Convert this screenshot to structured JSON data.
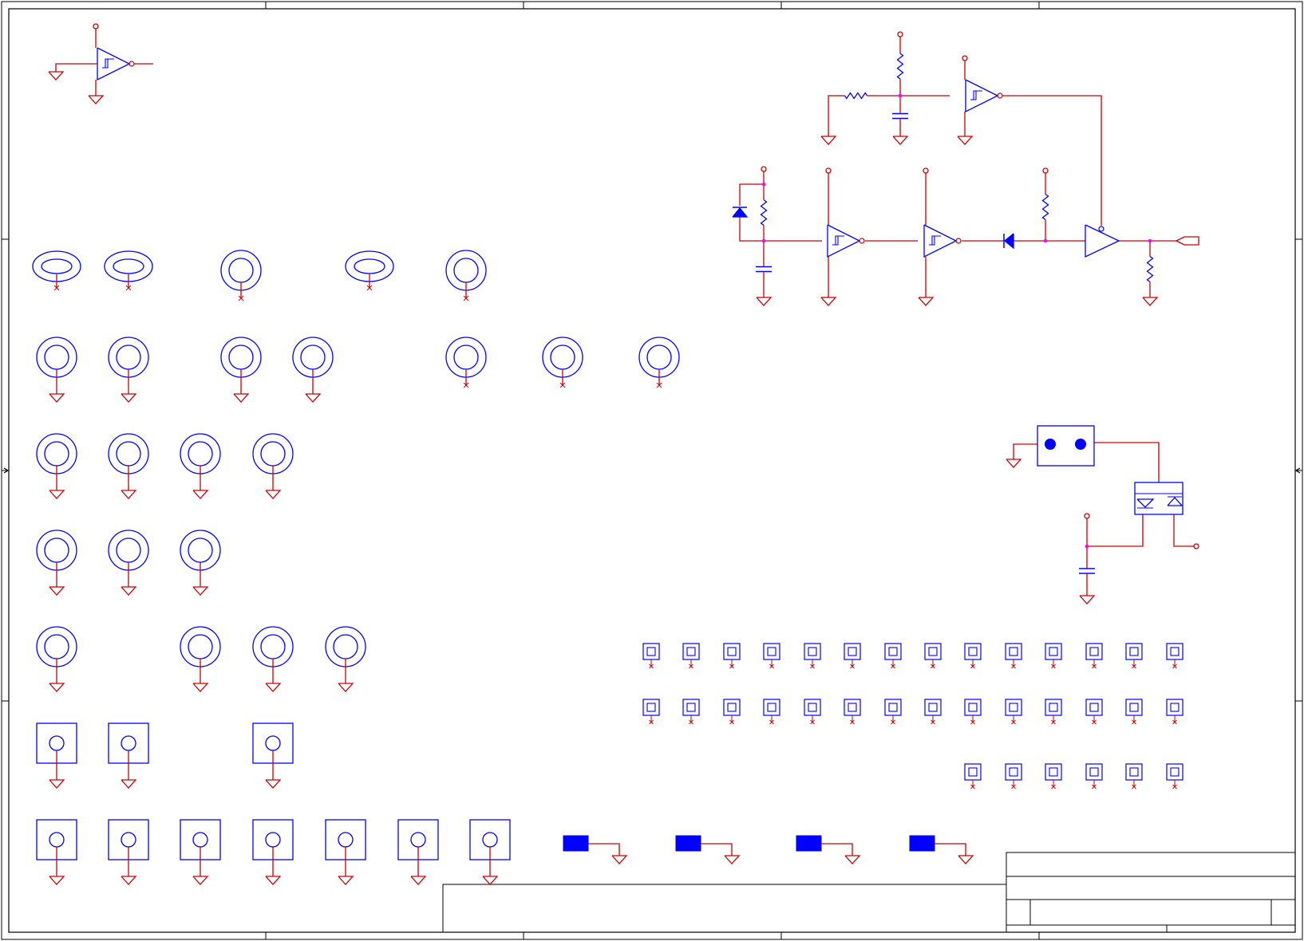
{
  "schematic": {
    "palette": {
      "frame": "#000000",
      "component": "#0000ff",
      "wire": "#cc0000",
      "junction": "#ff00ff",
      "fill_component": "#0000ff"
    },
    "component_groups": [
      {
        "kind": "schmitt-trigger-buffer",
        "count": 4
      },
      {
        "kind": "comparator-buffer",
        "count": 1
      },
      {
        "kind": "resistor",
        "count": 6
      },
      {
        "kind": "capacitor",
        "count": 3
      },
      {
        "kind": "diode",
        "count": 2
      },
      {
        "kind": "oval-mounting-hole",
        "count": 3
      },
      {
        "kind": "round-mounting-hole",
        "count": 24
      },
      {
        "kind": "square-mounting-pad",
        "count": 10
      },
      {
        "kind": "test-point",
        "count": 34
      },
      {
        "kind": "filled-pad",
        "count": 4
      },
      {
        "kind": "two-pin-connector",
        "count": 1
      },
      {
        "kind": "dual-switch-device",
        "count": 1
      }
    ],
    "title_block": {
      "visible_text": []
    }
  }
}
